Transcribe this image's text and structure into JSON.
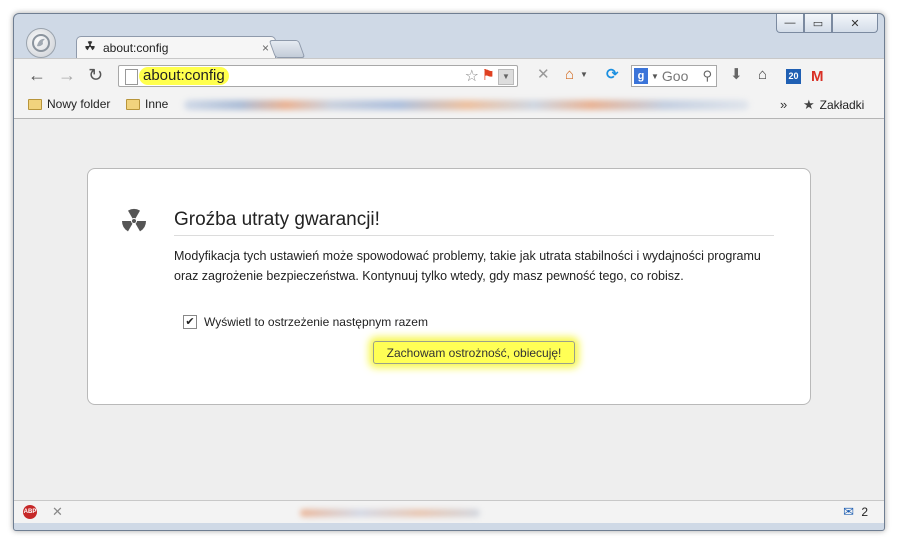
{
  "window": {
    "controls": {
      "minimize": "—",
      "maximize": "▭",
      "close": "✕"
    }
  },
  "tab": {
    "title": "about:config",
    "close": "×"
  },
  "toolbar": {
    "back": "←",
    "forward": "→",
    "reload": "↻",
    "url": "about:config",
    "search_placeholder": "Goo",
    "search_engine": "g",
    "calendar_day": "20",
    "gmail": "M"
  },
  "bookmarks": {
    "items": [
      {
        "label": "Nowy folder"
      },
      {
        "label": "Inne"
      }
    ],
    "overflow": "»",
    "bookmarks_menu": "Zakładki"
  },
  "warning": {
    "title": "Groźba utraty gwarancji!",
    "text": "Modyfikacja tych ustawień może spowodować problemy, takie jak utrata stabilności i wydajności programu oraz zagrożenie bezpieczeństwa. Kontynuuj tylko wtedy, gdy masz pewność tego, co robisz.",
    "checkbox_label": "Wyświetl to ostrzeżenie następnym razem",
    "checkbox_checked": true,
    "button_label": "Zachowam ostrożność, obiecuję!"
  },
  "statusbar": {
    "adblock": "ABP",
    "mail_count": "2"
  },
  "colors": {
    "highlight": "#ffff4d",
    "window_frame": "#cfd9e6",
    "content_bg": "#eeeeee"
  }
}
